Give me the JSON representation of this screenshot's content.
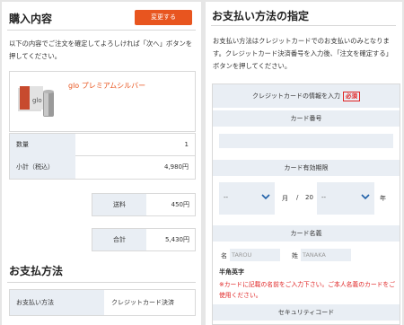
{
  "purchase": {
    "title": "購入内容",
    "change_button": "変更する",
    "intro": "以下の内容でご注文を確定してよろしければ「次へ」ボタンを押してください。",
    "product_name": "glo プレミアムシルバー",
    "rows": [
      {
        "label": "数量",
        "value": "1"
      },
      {
        "label": "小計（税込）",
        "value": "4,980円"
      }
    ],
    "shipping": {
      "label": "送料",
      "value": "450円"
    },
    "total": {
      "label": "合計",
      "value": "5,430円"
    }
  },
  "payment": {
    "title": "お支払方法",
    "label": "お支払い方法",
    "value": "クレジットカード決済"
  },
  "payment_spec": {
    "title": "お支払い方法の指定",
    "intro": "お支払い方法はクレジットカードでのお支払いのみとなります。クレジットカード決済番号を入力後、「注文を確定する」ボタンを押してください。",
    "cc_header": "クレジットカードの情報を入力",
    "required": "必須",
    "card_number_label": "カード番号",
    "expiry_label": "カード有効期限",
    "month_placeholder": "--",
    "month_unit": "月",
    "slash": "/",
    "year_prefix": "20",
    "year_placeholder": "--",
    "year_unit": "年",
    "card_name_label": "カード名義",
    "first_name_label": "名",
    "first_name_placeholder": "TAROU",
    "last_name_label": "姓",
    "last_name_placeholder": "TANAKA",
    "hankaku": "半角英字",
    "warning": "※カードに記載の名前をご入力下さい。ご本人名義のカードをご使用ください。",
    "security_label": "セキュリティコード"
  },
  "colors": {
    "accent": "#e8551f",
    "label_bg": "#e9eef4",
    "required": "#e02424"
  }
}
